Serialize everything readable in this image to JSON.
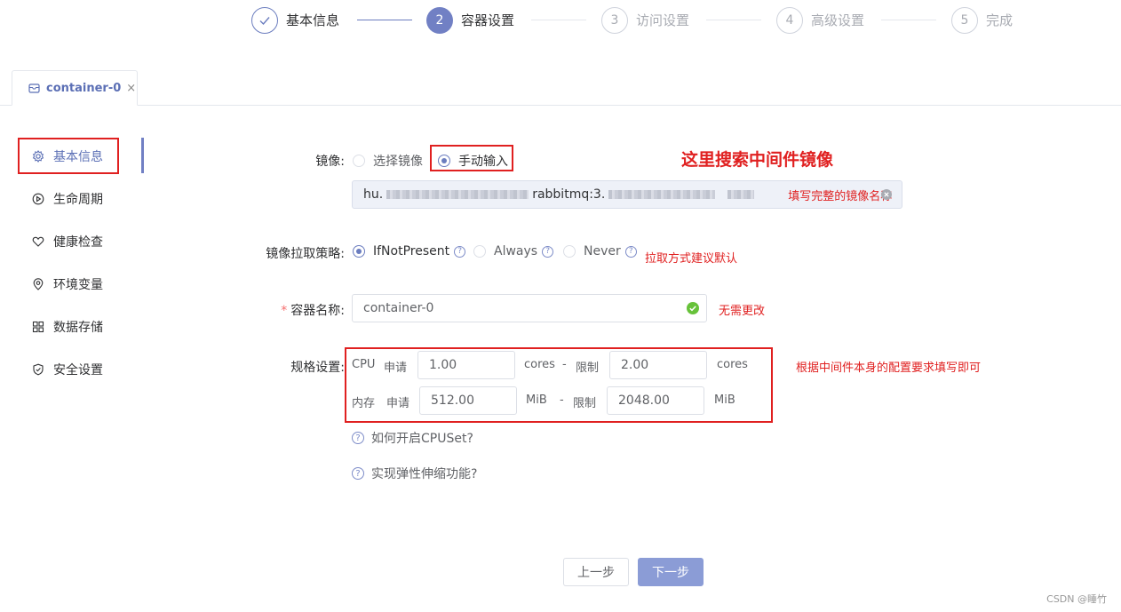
{
  "steps": [
    {
      "number": "",
      "label": "基本信息",
      "state": "done"
    },
    {
      "number": "2",
      "label": "容器设置",
      "state": "active"
    },
    {
      "number": "3",
      "label": "访问设置",
      "state": "todo"
    },
    {
      "number": "4",
      "label": "高级设置",
      "state": "todo"
    },
    {
      "number": "5",
      "label": "完成",
      "state": "todo"
    }
  ],
  "tab": {
    "label": "container-0",
    "close": "×"
  },
  "sidebar": {
    "items": [
      {
        "label": "基本信息",
        "icon": "gear-icon"
      },
      {
        "label": "生命周期",
        "icon": "play-circle-icon"
      },
      {
        "label": "健康检查",
        "icon": "heart-icon"
      },
      {
        "label": "环境变量",
        "icon": "location-pin-icon"
      },
      {
        "label": "数据存储",
        "icon": "grid-icon"
      },
      {
        "label": "安全设置",
        "icon": "shield-icon"
      }
    ]
  },
  "form": {
    "image": {
      "label": "镜像:",
      "option_select": "选择镜像",
      "option_manual": "手动输入",
      "value_visible": "rabbitmq:3.",
      "value_prefix": "hu.",
      "hint": "填写完整的镜像名称"
    },
    "pull_policy": {
      "label": "镜像拉取策略:",
      "options": [
        "IfNotPresent",
        "Always",
        "Never"
      ],
      "selected": "IfNotPresent"
    },
    "container_name": {
      "required_mark": "*",
      "label": "容器名称:",
      "value": "container-0"
    },
    "spec": {
      "label": "规格设置:",
      "cpu": {
        "label": "CPU",
        "request_label": "申请",
        "request": "1.00",
        "unit": "cores",
        "dash": "-",
        "limit_label": "限制",
        "limit": "2.00"
      },
      "memory": {
        "label": "内存",
        "request_label": "申请",
        "request": "512.00",
        "unit": "MiB",
        "dash": "-",
        "limit_label": "限制",
        "limit": "2048.00"
      }
    },
    "help_cpuset": "如何开启CPUSet?",
    "help_autoscale": "实现弹性伸缩功能?"
  },
  "annotations": {
    "search_image": "这里搜索中间件镜像",
    "pull_default": "拉取方式建议默认",
    "no_change": "无需更改",
    "spec_note": "根据中间件本身的配置要求填写即可"
  },
  "buttons": {
    "prev": "上一步",
    "next": "下一步"
  },
  "footer": "CSDN @睡竹",
  "colors": {
    "primary": "#7180c4",
    "annotation": "#e02020",
    "success": "#67c23a"
  }
}
